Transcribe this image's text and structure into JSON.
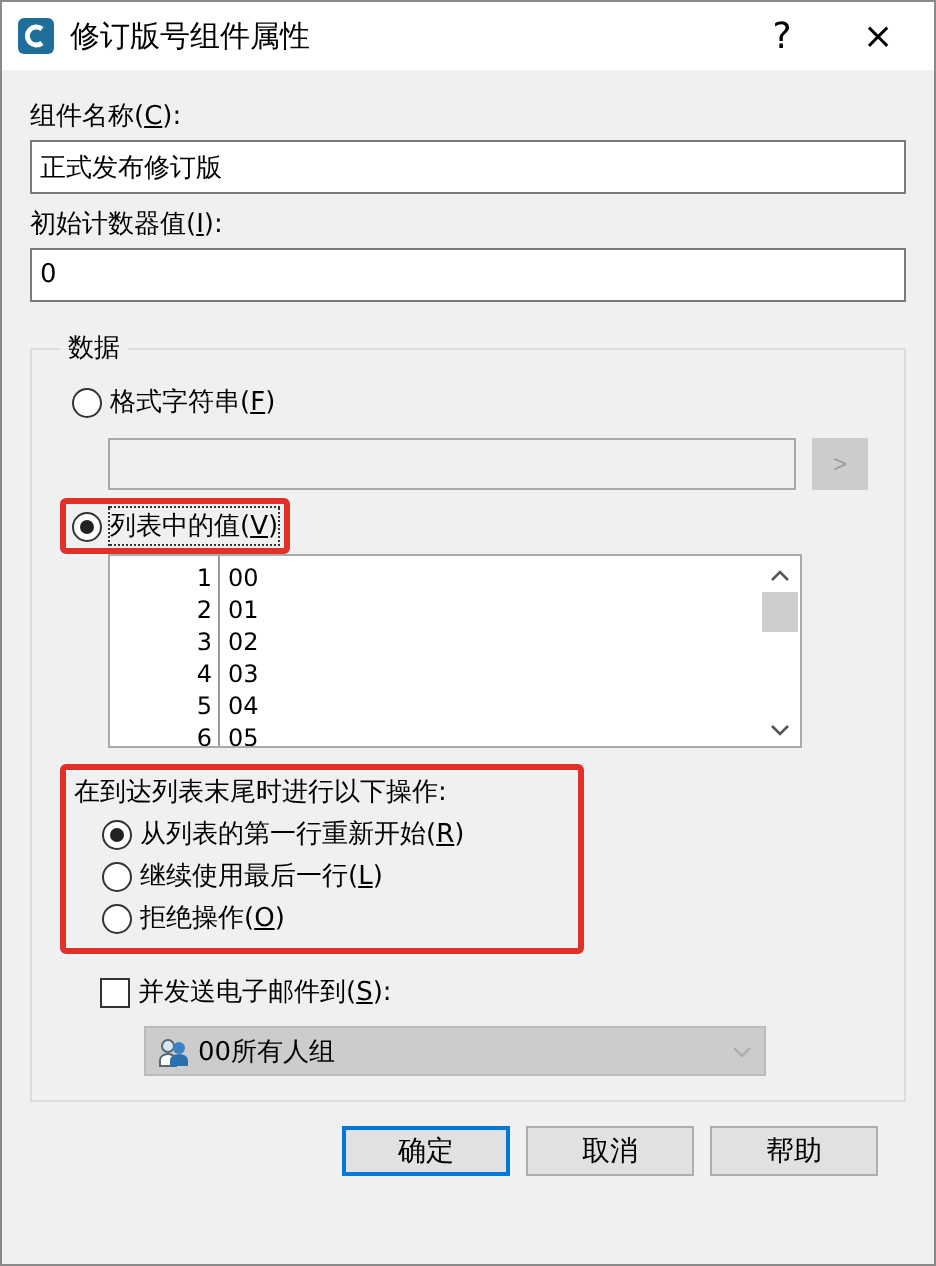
{
  "window": {
    "title": "修订版号组件属性",
    "help": "?",
    "close": "×"
  },
  "name_field": {
    "label": {
      "text": "组件名称(",
      "accel": "C",
      "tail": "):"
    },
    "value": "正式发布修订版"
  },
  "counter_field": {
    "label": {
      "text": "初始计数器值(",
      "accel": "I",
      "tail": "):"
    },
    "value": "0"
  },
  "data_group": {
    "title": "数据",
    "format_option": {
      "label": {
        "text": "格式字符串(",
        "accel": "F",
        "tail": ")"
      },
      "selected": false,
      "highlighted": false,
      "button": ">",
      "disabled": true
    },
    "list_option": {
      "label": {
        "text": "列表中的值(",
        "accel": "V",
        "tail": ")"
      },
      "selected": true,
      "highlighted": true
    },
    "list_rows": [
      {
        "number": "1",
        "value": "00"
      },
      {
        "number": "2",
        "value": "01"
      },
      {
        "number": "3",
        "value": "02"
      },
      {
        "number": "4",
        "value": "03"
      },
      {
        "number": "5",
        "value": "04"
      },
      {
        "number": "6",
        "value": "05"
      }
    ],
    "end_action": {
      "title": "在到达列表末尾时进行以下操作:",
      "highlighted": true,
      "options": [
        {
          "label": {
            "text": "从列表的第一行重新开始(",
            "accel": "R",
            "tail": ")"
          },
          "selected": true
        },
        {
          "label": {
            "text": "继续使用最后一行(",
            "accel": "L",
            "tail": ")"
          },
          "selected": false
        },
        {
          "label": {
            "text": "拒绝操作(",
            "accel": "O",
            "tail": ")"
          },
          "selected": false
        }
      ]
    },
    "email": {
      "label": {
        "text": "并发送电子邮件到(",
        "accel": "S",
        "tail": "):"
      },
      "checked": false,
      "recipient": "00所有人组",
      "disabled": true
    }
  },
  "buttons": [
    {
      "label": "确定",
      "default": true
    },
    {
      "label": "取消",
      "default": false
    },
    {
      "label": "帮助",
      "default": false
    }
  ]
}
